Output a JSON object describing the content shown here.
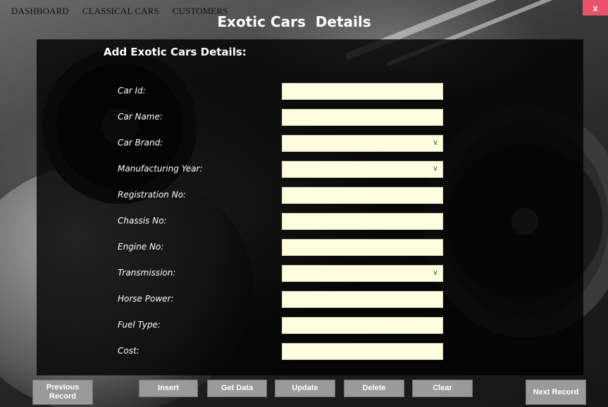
{
  "nav": {
    "items": [
      "DASHBOARD",
      "CLASSICAL CARS",
      "CUSTOMERS"
    ]
  },
  "window": {
    "close_label": "x",
    "close_color": "#e9536a"
  },
  "page": {
    "title": "Exotic Cars  Details",
    "section_title": "Add Exotic Cars Details:"
  },
  "form": {
    "fields": [
      {
        "label": "Car Id:",
        "type": "text",
        "value": ""
      },
      {
        "label": "Car Name:",
        "type": "text",
        "value": ""
      },
      {
        "label": "Car Brand:",
        "type": "select",
        "value": ""
      },
      {
        "label": "Manufacturing Year:",
        "type": "select",
        "value": ""
      },
      {
        "label": "Registration No:",
        "type": "text",
        "value": ""
      },
      {
        "label": "Chassis No:",
        "type": "text",
        "value": ""
      },
      {
        "label": "Engine No:",
        "type": "text",
        "value": ""
      },
      {
        "label": "Transmission:",
        "type": "select",
        "value": ""
      },
      {
        "label": "Horse Power:",
        "type": "text",
        "value": ""
      },
      {
        "label": "Fuel Type:",
        "type": "text",
        "value": ""
      },
      {
        "label": "Cost:",
        "type": "text",
        "value": ""
      }
    ],
    "field_bg": "#fffee0"
  },
  "buttons": {
    "previous": "Previous Record",
    "insert": "Insert",
    "get_data": "Get Data",
    "update": "Update",
    "delete": "Delete",
    "clear": "Clear",
    "next": "Next Record",
    "color": "#9a9a9a"
  },
  "icons": {
    "dropdown": "chevron-down-icon",
    "close": "close-icon"
  }
}
